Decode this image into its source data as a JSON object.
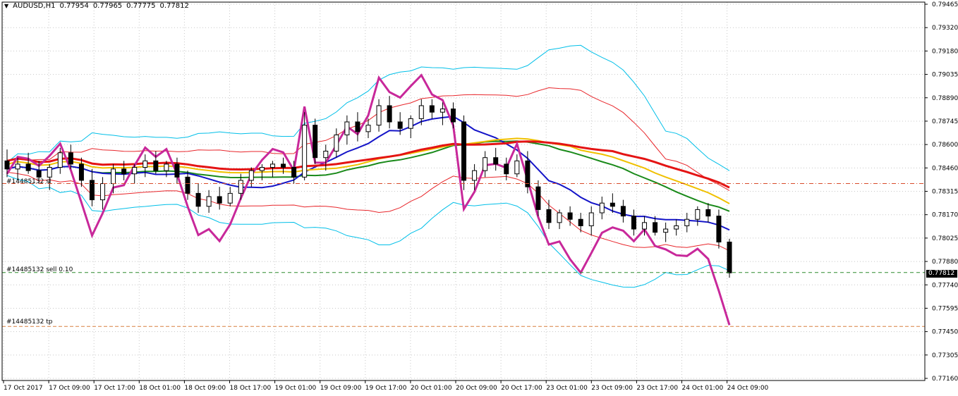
{
  "header": {
    "symbol": "AUDUSD,H1",
    "open": "0.77954",
    "high": "0.77965",
    "low": "0.77775",
    "close": "0.77812"
  },
  "orders": {
    "sl_label": "#14485132 sl",
    "sell_label": "#14485132 sell 0.10",
    "tp_label": "#14485132 tp",
    "sl_price": 0.7836,
    "sell_price": 0.77812,
    "tp_price": 0.7748
  },
  "current_price_label": "0.77812",
  "colors": {
    "background": "#ffffff",
    "grid": "#c8c8c8",
    "candle_body": "#000000",
    "bb_outer": "#00bfe8",
    "envelope": "#e8262b",
    "ma_green": "#1a8a1a",
    "ma_blue": "#1414c8",
    "ichimoku_red": "#e41414",
    "ichimoku_yellow": "#f0c000",
    "oscillator_magenta": "#c8289a",
    "sl_line": "#d84b2a",
    "sell_line": "#2e8b2e",
    "tp_line": "#d88040"
  },
  "chart_data": {
    "type": "candlestick",
    "symbol": "AUDUSD",
    "timeframe": "H1",
    "y_axis_ticks": [
      "0.79465",
      "0.79320",
      "0.79180",
      "0.79035",
      "0.78890",
      "0.78745",
      "0.78600",
      "0.78460",
      "0.78315",
      "0.78170",
      "0.78025",
      "0.77880",
      "0.77740",
      "0.77595",
      "0.77450",
      "0.77305",
      "0.77160"
    ],
    "ylim": [
      0.7716,
      0.79465
    ],
    "x_axis_ticks": [
      "17 Oct 2017",
      "17 Oct 09:00",
      "17 Oct 17:00",
      "18 Oct 01:00",
      "18 Oct 09:00",
      "18 Oct 17:00",
      "19 Oct 01:00",
      "19 Oct 09:00",
      "19 Oct 17:00",
      "20 Oct 01:00",
      "20 Oct 09:00",
      "20 Oct 17:00",
      "23 Oct 01:00",
      "23 Oct 09:00",
      "23 Oct 17:00",
      "24 Oct 01:00",
      "24 Oct 09:00"
    ],
    "candles_ohlc_approx": [
      [
        0.785,
        0.7857,
        0.784,
        0.7845
      ],
      [
        0.7845,
        0.7852,
        0.7838,
        0.7848
      ],
      [
        0.7848,
        0.7855,
        0.7842,
        0.7844
      ],
      [
        0.7844,
        0.785,
        0.7836,
        0.784
      ],
      [
        0.784,
        0.7848,
        0.7832,
        0.7846
      ],
      [
        0.7846,
        0.7858,
        0.7842,
        0.7855
      ],
      [
        0.7855,
        0.786,
        0.7845,
        0.7848
      ],
      [
        0.7848,
        0.7852,
        0.7834,
        0.7838
      ],
      [
        0.7838,
        0.7845,
        0.7822,
        0.7826
      ],
      [
        0.7826,
        0.784,
        0.782,
        0.7836
      ],
      [
        0.7836,
        0.7848,
        0.783,
        0.7845
      ],
      [
        0.7845,
        0.785,
        0.7838,
        0.7842
      ],
      [
        0.7842,
        0.7848,
        0.7836,
        0.7846
      ],
      [
        0.7846,
        0.7854,
        0.784,
        0.785
      ],
      [
        0.785,
        0.7856,
        0.7842,
        0.7844
      ],
      [
        0.7844,
        0.785,
        0.784,
        0.7848
      ],
      [
        0.7848,
        0.7852,
        0.7836,
        0.784
      ],
      [
        0.784,
        0.7844,
        0.7826,
        0.783
      ],
      [
        0.783,
        0.7836,
        0.7818,
        0.7822
      ],
      [
        0.7822,
        0.7832,
        0.7818,
        0.7828
      ],
      [
        0.7828,
        0.7834,
        0.782,
        0.7824
      ],
      [
        0.7824,
        0.7834,
        0.7822,
        0.783
      ],
      [
        0.783,
        0.7842,
        0.7826,
        0.7838
      ],
      [
        0.7838,
        0.7846,
        0.7834,
        0.7844
      ],
      [
        0.7844,
        0.7848,
        0.7838,
        0.7846
      ],
      [
        0.7846,
        0.785,
        0.784,
        0.7848
      ],
      [
        0.7848,
        0.7852,
        0.7842,
        0.7846
      ],
      [
        0.7846,
        0.785,
        0.7836,
        0.784
      ],
      [
        0.784,
        0.788,
        0.7838,
        0.7872
      ],
      [
        0.7872,
        0.7876,
        0.7848,
        0.7852
      ],
      [
        0.7852,
        0.786,
        0.7844,
        0.7856
      ],
      [
        0.7856,
        0.787,
        0.7852,
        0.7866
      ],
      [
        0.7866,
        0.7878,
        0.786,
        0.7874
      ],
      [
        0.7874,
        0.788,
        0.7862,
        0.7868
      ],
      [
        0.7868,
        0.7876,
        0.7864,
        0.7872
      ],
      [
        0.7872,
        0.7888,
        0.7868,
        0.7884
      ],
      [
        0.7884,
        0.789,
        0.787,
        0.7874
      ],
      [
        0.7874,
        0.788,
        0.7866,
        0.787
      ],
      [
        0.787,
        0.7878,
        0.7864,
        0.7876
      ],
      [
        0.7876,
        0.7888,
        0.7872,
        0.7884
      ],
      [
        0.7884,
        0.7888,
        0.7876,
        0.788
      ],
      [
        0.788,
        0.7886,
        0.7872,
        0.7882
      ],
      [
        0.7882,
        0.7886,
        0.787,
        0.7874
      ],
      [
        0.7874,
        0.7878,
        0.7832,
        0.7838
      ],
      [
        0.7838,
        0.7848,
        0.7832,
        0.7844
      ],
      [
        0.7844,
        0.7856,
        0.784,
        0.7852
      ],
      [
        0.7852,
        0.7858,
        0.7844,
        0.7848
      ],
      [
        0.7848,
        0.7852,
        0.7838,
        0.7842
      ],
      [
        0.7842,
        0.7854,
        0.784,
        0.785
      ],
      [
        0.785,
        0.7856,
        0.783,
        0.7834
      ],
      [
        0.7834,
        0.7838,
        0.7816,
        0.782
      ],
      [
        0.782,
        0.7826,
        0.7808,
        0.7812
      ],
      [
        0.7812,
        0.782,
        0.7808,
        0.7818
      ],
      [
        0.7818,
        0.7822,
        0.781,
        0.7814
      ],
      [
        0.7814,
        0.7818,
        0.7806,
        0.781
      ],
      [
        0.781,
        0.7822,
        0.7804,
        0.7818
      ],
      [
        0.7818,
        0.7828,
        0.7814,
        0.7824
      ],
      [
        0.7824,
        0.783,
        0.7818,
        0.7822
      ],
      [
        0.7822,
        0.7826,
        0.7812,
        0.7816
      ],
      [
        0.7816,
        0.782,
        0.7804,
        0.7808
      ],
      [
        0.7808,
        0.7816,
        0.7804,
        0.7812
      ],
      [
        0.7812,
        0.7816,
        0.7804,
        0.7806
      ],
      [
        0.7806,
        0.7812,
        0.78,
        0.7808
      ],
      [
        0.7808,
        0.7814,
        0.7804,
        0.781
      ],
      [
        0.781,
        0.7818,
        0.7806,
        0.7814
      ],
      [
        0.7814,
        0.7822,
        0.781,
        0.782
      ],
      [
        0.782,
        0.7824,
        0.7812,
        0.7816
      ],
      [
        0.7816,
        0.782,
        0.7796,
        0.78
      ],
      [
        0.78,
        0.7802,
        0.7778,
        0.7781
      ]
    ]
  }
}
